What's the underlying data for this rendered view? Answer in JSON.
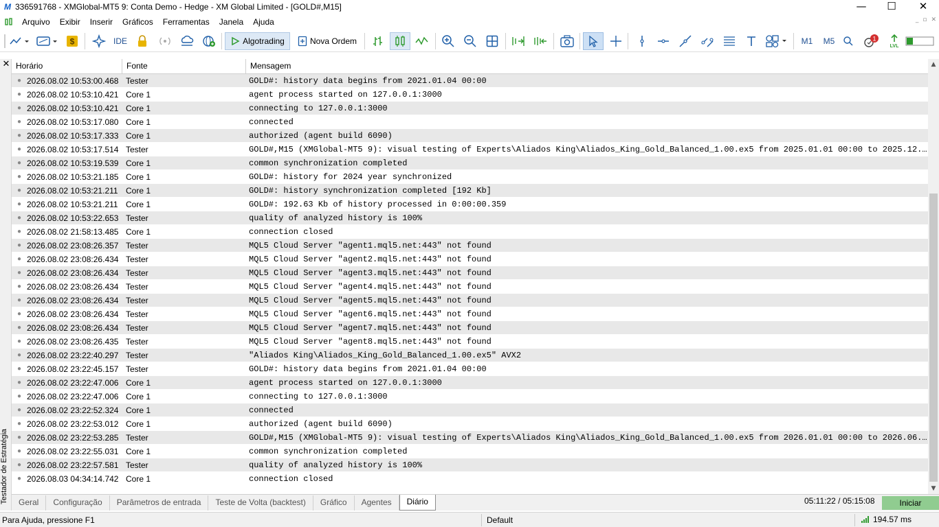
{
  "window": {
    "logo": "M",
    "title": "336591768 - XMGlobal-MT5 9: Conta Demo - Hedge - XM Global Limited - [GOLD#,M15]",
    "min": "—",
    "max": "☐",
    "close": "✕"
  },
  "menu": [
    "Arquivo",
    "Exibir",
    "Inserir",
    "Gráficos",
    "Ferramentas",
    "Janela",
    "Ajuda"
  ],
  "mdi": {
    "min": "_",
    "restore": "▫",
    "close": "✕"
  },
  "toolbar": {
    "ide_label": "IDE",
    "algotrading_label": "Algotrading",
    "new_order_label": "Nova Ordem",
    "tf_m1": "M1",
    "tf_m5": "M5",
    "notification_count": "1",
    "colors": {
      "accent": "#1f5fa8",
      "green": "#2e9a2e",
      "yellow": "#e8b400",
      "red": "#d32f2f"
    }
  },
  "panel": {
    "title": "Testador de Estratégia",
    "close": "✕"
  },
  "table": {
    "headers": [
      "Horário",
      "Fonte",
      "Mensagem"
    ],
    "rows": [
      {
        "time": "2026.08.02 10:53:00.468",
        "source": "Tester",
        "message": "GOLD#: history data begins from 2021.01.04 00:00"
      },
      {
        "time": "2026.08.02 10:53:10.421",
        "source": "Core 1",
        "message": "agent process started on 127.0.0.1:3000"
      },
      {
        "time": "2026.08.02 10:53:10.421",
        "source": "Core 1",
        "message": "connecting to 127.0.0.1:3000"
      },
      {
        "time": "2026.08.02 10:53:17.080",
        "source": "Core 1",
        "message": "connected"
      },
      {
        "time": "2026.08.02 10:53:17.333",
        "source": "Core 1",
        "message": "authorized (agent build 6090)"
      },
      {
        "time": "2026.08.02 10:53:17.514",
        "source": "Tester",
        "message": "GOLD#,M15 (XMGlobal-MT5 9): visual testing of Experts\\Aliados King\\Aliados_King_Gold_Balanced_1.00.ex5 from 2025.01.01 00:00 to 2025.12.3..."
      },
      {
        "time": "2026.08.02 10:53:19.539",
        "source": "Core 1",
        "message": "common synchronization completed"
      },
      {
        "time": "2026.08.02 10:53:21.185",
        "source": "Core 1",
        "message": "GOLD#: history for 2024 year synchronized"
      },
      {
        "time": "2026.08.02 10:53:21.211",
        "source": "Core 1",
        "message": "GOLD#: history synchronization completed [192 Kb]"
      },
      {
        "time": "2026.08.02 10:53:21.211",
        "source": "Core 1",
        "message": "GOLD#: 192.63 Kb of history processed in 0:00:00.359"
      },
      {
        "time": "2026.08.02 10:53:22.653",
        "source": "Tester",
        "message": "quality of analyzed history is 100%"
      },
      {
        "time": "2026.08.02 21:58:13.485",
        "source": "Core 1",
        "message": "connection closed"
      },
      {
        "time": "2026.08.02 23:08:26.357",
        "source": "Tester",
        "message": "MQL5 Cloud Server \"agent1.mql5.net:443\" not found"
      },
      {
        "time": "2026.08.02 23:08:26.434",
        "source": "Tester",
        "message": "MQL5 Cloud Server \"agent2.mql5.net:443\" not found"
      },
      {
        "time": "2026.08.02 23:08:26.434",
        "source": "Tester",
        "message": "MQL5 Cloud Server \"agent3.mql5.net:443\" not found"
      },
      {
        "time": "2026.08.02 23:08:26.434",
        "source": "Tester",
        "message": "MQL5 Cloud Server \"agent4.mql5.net:443\" not found"
      },
      {
        "time": "2026.08.02 23:08:26.434",
        "source": "Tester",
        "message": "MQL5 Cloud Server \"agent5.mql5.net:443\" not found"
      },
      {
        "time": "2026.08.02 23:08:26.434",
        "source": "Tester",
        "message": "MQL5 Cloud Server \"agent6.mql5.net:443\" not found"
      },
      {
        "time": "2026.08.02 23:08:26.434",
        "source": "Tester",
        "message": "MQL5 Cloud Server \"agent7.mql5.net:443\" not found"
      },
      {
        "time": "2026.08.02 23:08:26.435",
        "source": "Tester",
        "message": "MQL5 Cloud Server \"agent8.mql5.net:443\" not found"
      },
      {
        "time": "2026.08.02 23:22:40.297",
        "source": "Tester",
        "message": "\"Aliados King\\Aliados_King_Gold_Balanced_1.00.ex5\" AVX2"
      },
      {
        "time": "2026.08.02 23:22:45.157",
        "source": "Tester",
        "message": "GOLD#: history data begins from 2021.01.04 00:00"
      },
      {
        "time": "2026.08.02 23:22:47.006",
        "source": "Core 1",
        "message": "agent process started on 127.0.0.1:3000"
      },
      {
        "time": "2026.08.02 23:22:47.006",
        "source": "Core 1",
        "message": "connecting to 127.0.0.1:3000"
      },
      {
        "time": "2026.08.02 23:22:52.324",
        "source": "Core 1",
        "message": "connected"
      },
      {
        "time": "2026.08.02 23:22:53.012",
        "source": "Core 1",
        "message": "authorized (agent build 6090)"
      },
      {
        "time": "2026.08.02 23:22:53.285",
        "source": "Tester",
        "message": "GOLD#,M15 (XMGlobal-MT5 9): visual testing of Experts\\Aliados King\\Aliados_King_Gold_Balanced_1.00.ex5 from 2026.01.01 00:00 to 2026.06.2..."
      },
      {
        "time": "2026.08.02 23:22:55.031",
        "source": "Core 1",
        "message": "common synchronization completed"
      },
      {
        "time": "2026.08.02 23:22:57.581",
        "source": "Tester",
        "message": "quality of analyzed history is 100%"
      },
      {
        "time": "2026.08.03 04:34:14.742",
        "source": "Core 1",
        "message": "connection closed"
      }
    ]
  },
  "scroll": {
    "up": "▲",
    "down": "▼"
  },
  "tabs": [
    {
      "label": "Geral",
      "active": false
    },
    {
      "label": "Configuração",
      "active": false
    },
    {
      "label": "Parâmetros de entrada",
      "active": false
    },
    {
      "label": "Teste de Volta (backtest)",
      "active": false
    },
    {
      "label": "Gráfico",
      "active": false
    },
    {
      "label": "Agentes",
      "active": false
    },
    {
      "label": "Diário",
      "active": true
    }
  ],
  "tester": {
    "time_readout": "05:11:22 / 05:15:08",
    "start_label": "Iniciar"
  },
  "status": {
    "help": "Para Ajuda, pressione F1",
    "profile": "Default",
    "ping": "194.57 ms"
  }
}
